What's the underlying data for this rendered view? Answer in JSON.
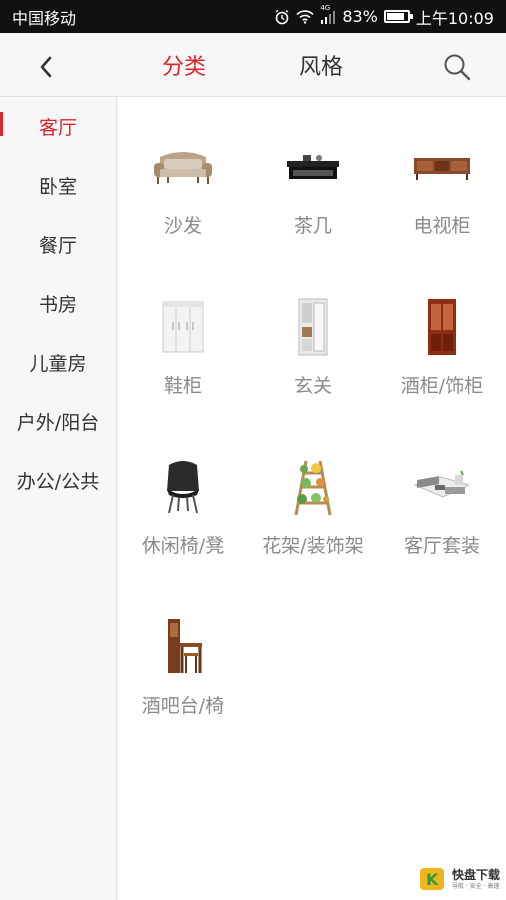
{
  "status_bar": {
    "carrier": "中国移动",
    "network": "4G",
    "battery": "83%",
    "battery_level": 0.83,
    "time": "上午10:09"
  },
  "header": {
    "tabs": [
      {
        "label": "分类",
        "active": true
      },
      {
        "label": "风格",
        "active": false
      }
    ],
    "back_icon": "chevron-left-icon",
    "search_icon": "search-icon"
  },
  "sidebar": {
    "items": [
      {
        "label": "客厅",
        "active": true
      },
      {
        "label": "卧室",
        "active": false
      },
      {
        "label": "餐厅",
        "active": false
      },
      {
        "label": "书房",
        "active": false
      },
      {
        "label": "儿童房",
        "active": false
      },
      {
        "label": "户外/阳台",
        "active": false
      },
      {
        "label": "办公/公共",
        "active": false
      }
    ]
  },
  "categories": [
    {
      "label": "沙发",
      "icon": "sofa-icon"
    },
    {
      "label": "茶几",
      "icon": "coffee-table-icon"
    },
    {
      "label": "电视柜",
      "icon": "tv-cabinet-icon"
    },
    {
      "label": "鞋柜",
      "icon": "shoe-cabinet-icon"
    },
    {
      "label": "玄关",
      "icon": "entryway-cabinet-icon"
    },
    {
      "label": "酒柜/饰柜",
      "icon": "wine-cabinet-icon"
    },
    {
      "label": "休闲椅/凳",
      "icon": "lounge-chair-icon"
    },
    {
      "label": "花架/装饰架",
      "icon": "plant-stand-icon"
    },
    {
      "label": "客厅套装",
      "icon": "living-room-set-icon"
    },
    {
      "label": "酒吧台/椅",
      "icon": "bar-counter-icon"
    }
  ],
  "watermark": {
    "logo_char": "K",
    "text": "快盘下载",
    "subtext": "导航 · 安全 · 高速"
  },
  "colors": {
    "accent": "#d9262b",
    "label_gray": "#8a8a8a",
    "background": "#f7f7f7"
  }
}
